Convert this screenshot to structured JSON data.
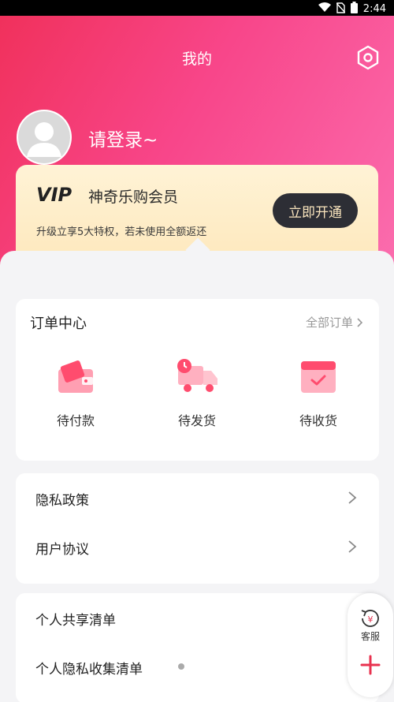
{
  "status_bar": {
    "time": "2:44"
  },
  "header": {
    "title": "我的"
  },
  "profile": {
    "login_prompt": "请登录~"
  },
  "vip": {
    "logo_text": "VIP",
    "name": "神奇乐购会员",
    "description": "升级立享5大特权，若未使用全额返还",
    "button_label": "立即开通"
  },
  "orders": {
    "title": "订单中心",
    "all_label": "全部订单",
    "items": [
      {
        "label": "待付款",
        "icon": "wallet-icon"
      },
      {
        "label": "待发货",
        "icon": "truck-icon"
      },
      {
        "label": "待收货",
        "icon": "calendar-check-icon"
      }
    ]
  },
  "menu": [
    {
      "label": "隐私政策"
    },
    {
      "label": "用户协议"
    }
  ],
  "menu2": [
    {
      "label": "个人共享清单"
    },
    {
      "label": "个人隐私收集清单"
    }
  ],
  "floating": {
    "service_label": "客服"
  },
  "colors": {
    "accent": "#f8468a",
    "hero_start": "#f0305a",
    "hero_end": "#fb6fb0",
    "vip_button": "#2d2e35",
    "vip_card": "#fde6b8"
  }
}
